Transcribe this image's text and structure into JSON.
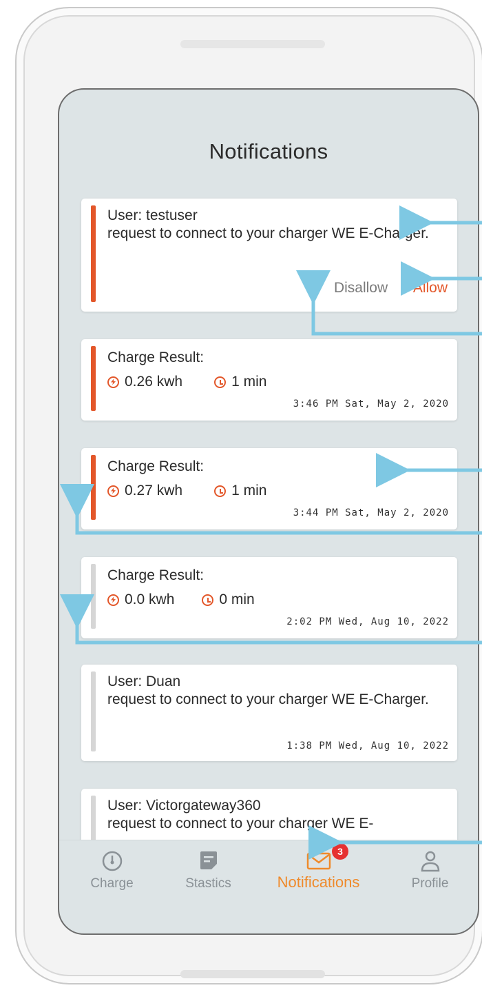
{
  "screen": {
    "title": "Notifications"
  },
  "notifications": [
    {
      "kind": "request",
      "user_line": "User: testuser",
      "message": "request to connect to your charger WE E-Charger.",
      "disallow_label": "Disallow",
      "allow_label": "Allow",
      "unread": true
    },
    {
      "kind": "result",
      "title": "Charge Result:",
      "energy": "0.26 kwh",
      "duration": "1 min",
      "timestamp": "3:46 PM Sat, May 2, 2020",
      "unread": true
    },
    {
      "kind": "result",
      "title": "Charge Result:",
      "energy": "0.27 kwh",
      "duration": "1 min",
      "timestamp": "3:44 PM Sat, May 2, 2020",
      "unread": true
    },
    {
      "kind": "result",
      "title": "Charge Result:",
      "energy": "0.0 kwh",
      "duration": "0 min",
      "timestamp": "2:02 PM Wed, Aug 10, 2022",
      "unread": false
    },
    {
      "kind": "request",
      "user_line": "User: Duan",
      "message": "request to connect to your charger WE E-Charger.",
      "timestamp": "1:38 PM Wed, Aug 10, 2022",
      "unread": false
    },
    {
      "kind": "request",
      "user_line": "User: Victorgateway360",
      "message": "request to connect to your charger WE E-",
      "unread": false
    }
  ],
  "nav": {
    "items": [
      {
        "label": "Charge",
        "icon": "gauge-icon"
      },
      {
        "label": "Stastics",
        "icon": "stats-icon"
      },
      {
        "label": "Notifications",
        "icon": "mail-icon",
        "active": true,
        "badge": "3"
      },
      {
        "label": "Profile",
        "icon": "profile-icon"
      }
    ]
  },
  "colors": {
    "accent": "#e3572a",
    "nav_active": "#ef8a2b",
    "read_bar": "#d6d6d6",
    "annotation": "#7ec8e3",
    "badge": "#e63131"
  }
}
